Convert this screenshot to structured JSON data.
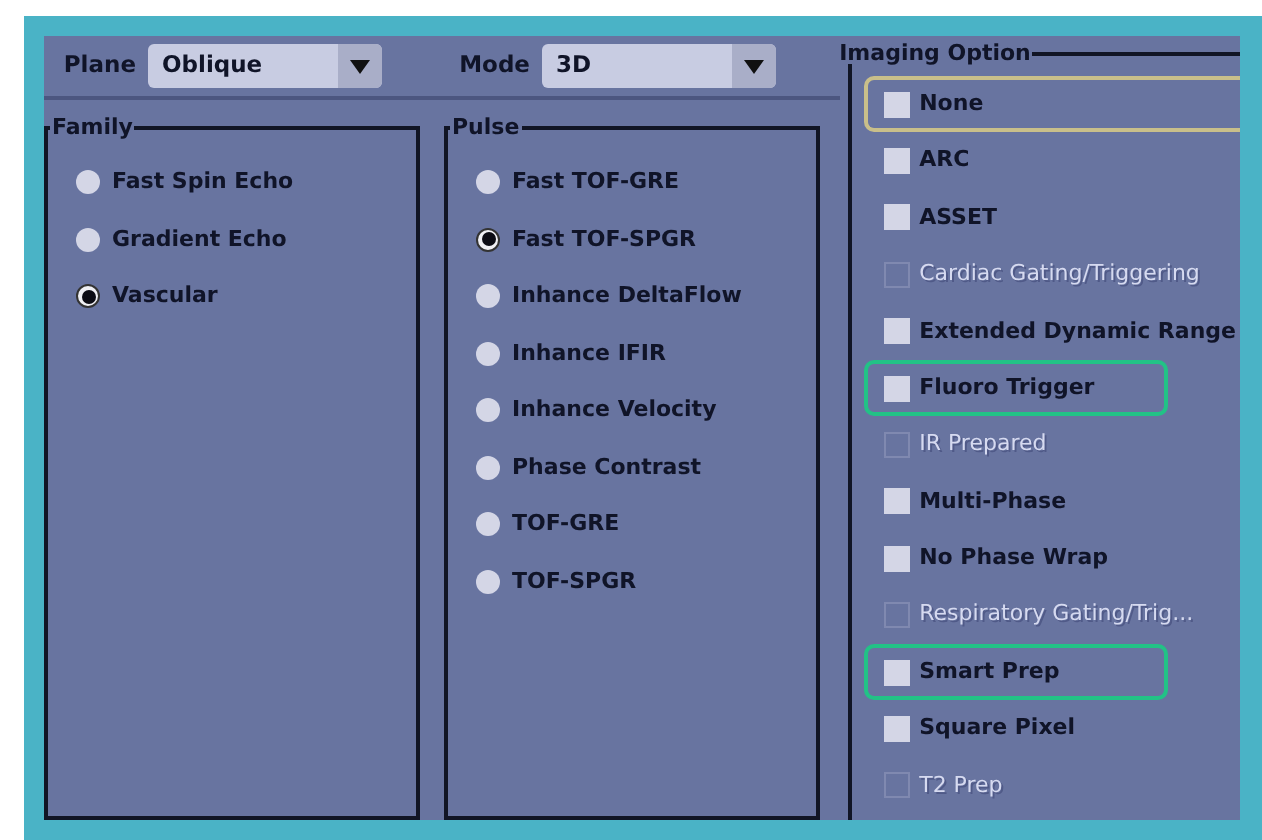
{
  "selectors": [
    {
      "label": "Plane",
      "value": "Oblique"
    },
    {
      "label": "Mode",
      "value": "3D"
    }
  ],
  "family": {
    "title": "Family",
    "items": [
      {
        "label": "Fast Spin Echo",
        "selected": false
      },
      {
        "label": "Gradient Echo",
        "selected": false
      },
      {
        "label": "Vascular",
        "selected": true
      }
    ]
  },
  "pulse": {
    "title": "Pulse",
    "items": [
      {
        "label": "Fast TOF-GRE",
        "selected": false
      },
      {
        "label": "Fast TOF-SPGR",
        "selected": true
      },
      {
        "label": "Inhance DeltaFlow",
        "selected": false
      },
      {
        "label": "Inhance IFIR",
        "selected": false
      },
      {
        "label": "Inhance Velocity",
        "selected": false
      },
      {
        "label": "Phase Contrast",
        "selected": false
      },
      {
        "label": "TOF-GRE",
        "selected": false
      },
      {
        "label": "TOF-SPGR",
        "selected": false
      }
    ]
  },
  "imaging_option": {
    "title": "Imaging Option",
    "items": [
      {
        "label": "None",
        "checked": false,
        "disabled": false,
        "focused": true,
        "highlighted": false
      },
      {
        "label": "ARC",
        "checked": false,
        "disabled": false,
        "focused": false,
        "highlighted": false
      },
      {
        "label": "ASSET",
        "checked": false,
        "disabled": false,
        "focused": false,
        "highlighted": false
      },
      {
        "label": "Cardiac Gating/Triggering",
        "checked": false,
        "disabled": true,
        "focused": false,
        "highlighted": false
      },
      {
        "label": "Extended Dynamic Range",
        "checked": false,
        "disabled": false,
        "focused": false,
        "highlighted": false
      },
      {
        "label": "Fluoro Trigger",
        "checked": false,
        "disabled": false,
        "focused": false,
        "highlighted": true
      },
      {
        "label": "IR Prepared",
        "checked": false,
        "disabled": true,
        "focused": false,
        "highlighted": false
      },
      {
        "label": "Multi-Phase",
        "checked": false,
        "disabled": false,
        "focused": false,
        "highlighted": false
      },
      {
        "label": "No Phase Wrap",
        "checked": false,
        "disabled": false,
        "focused": false,
        "highlighted": false
      },
      {
        "label": "Respiratory Gating/Trig...",
        "checked": false,
        "disabled": true,
        "focused": false,
        "highlighted": false
      },
      {
        "label": "Smart Prep",
        "checked": false,
        "disabled": false,
        "focused": false,
        "highlighted": true
      },
      {
        "label": "Square Pixel",
        "checked": false,
        "disabled": false,
        "focused": false,
        "highlighted": false
      },
      {
        "label": "T2 Prep",
        "checked": false,
        "disabled": true,
        "focused": false,
        "highlighted": false
      }
    ]
  }
}
